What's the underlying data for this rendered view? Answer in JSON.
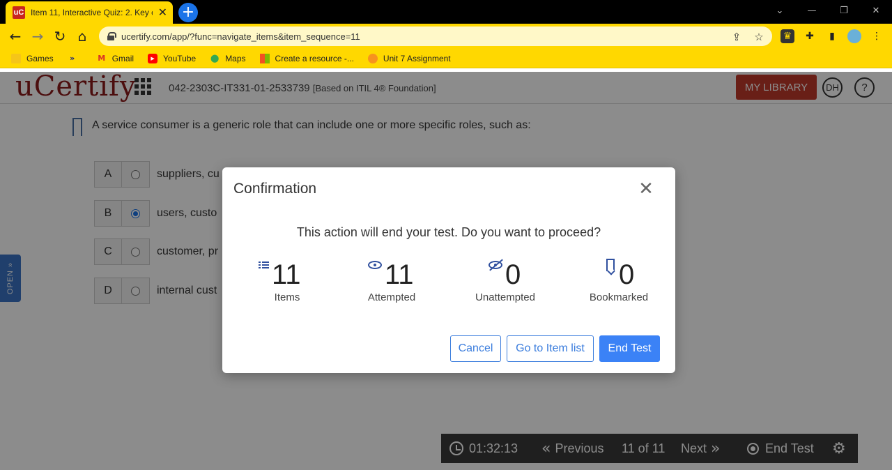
{
  "browser": {
    "tab_title": "Item 11, Interactive Quiz: 2. Key c",
    "tab_favicon": "uC",
    "url": "ucertify.com/app/?func=navigate_items&item_sequence=11",
    "bookmarks": [
      {
        "label": "Games",
        "icon": "folder-icon"
      },
      {
        "label": "",
        "icon": "double-chevron-icon"
      },
      {
        "label": "Gmail",
        "icon": "gmail-icon"
      },
      {
        "label": "YouTube",
        "icon": "youtube-icon"
      },
      {
        "label": "Maps",
        "icon": "maps-icon"
      },
      {
        "label": "Create a resource -...",
        "icon": "microsoft-icon"
      },
      {
        "label": "Unit 7 Assignment",
        "icon": "app-icon"
      }
    ]
  },
  "header": {
    "logo": "uCertify",
    "course_title": "042-2303C-IT331-01-2533739",
    "course_sub": "[Based on ITIL 4® Foundation]",
    "my_library": "MY LIBRARY",
    "avatar": "DH",
    "help": "?"
  },
  "question": {
    "text": "A service consumer is a generic role that can include one or more specific roles, such as:",
    "options": [
      {
        "letter": "A",
        "text": "suppliers, cu",
        "selected": false
      },
      {
        "letter": "B",
        "text": "users, custo",
        "selected": true
      },
      {
        "letter": "C",
        "text": "customer, pr",
        "selected": false
      },
      {
        "letter": "D",
        "text": "internal cust",
        "selected": false
      }
    ]
  },
  "side_tab": "OPEN »",
  "footer": {
    "timer": "01:32:13",
    "previous": "Previous",
    "position": "11 of 11",
    "next": "Next",
    "end_test": "End Test"
  },
  "modal": {
    "title": "Confirmation",
    "message": "This action will end your test. Do you want to proceed?",
    "stats": [
      {
        "value": "11",
        "label": "Items",
        "icon": "list-icon"
      },
      {
        "value": "11",
        "label": "Attempted",
        "icon": "eye-icon"
      },
      {
        "value": "0",
        "label": "Unattempted",
        "icon": "eye-slash-icon"
      },
      {
        "value": "0",
        "label": "Bookmarked",
        "icon": "bookmark-icon"
      }
    ],
    "buttons": {
      "cancel": "Cancel",
      "item_list": "Go to Item list",
      "end_test": "End Test"
    }
  },
  "colors": {
    "chrome_accent": "#ffd800",
    "brand": "#8b1a1a",
    "my_library": "#c0392b",
    "primary": "#3b82f6"
  }
}
